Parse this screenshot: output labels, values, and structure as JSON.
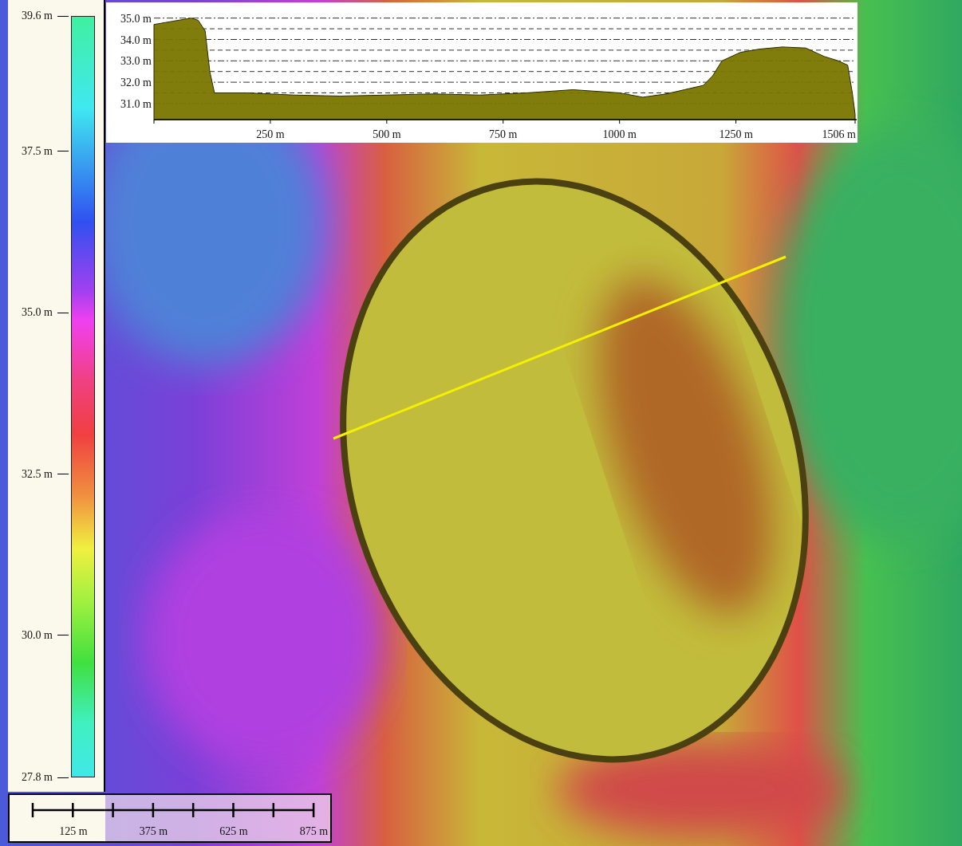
{
  "legend": {
    "labels": [
      "39.6 m",
      "37.5 m",
      "35.0 m",
      "32.5 m",
      "30.0 m",
      "27.8 m"
    ]
  },
  "profile": {
    "chart_data": {
      "type": "area",
      "x": [
        0,
        40,
        80,
        95,
        110,
        120,
        130,
        200,
        300,
        400,
        500,
        600,
        700,
        800,
        900,
        1000,
        1050,
        1100,
        1150,
        1180,
        1200,
        1220,
        1260,
        1300,
        1350,
        1400,
        1440,
        1470,
        1490,
        1500,
        1506
      ],
      "series": [
        {
          "color": "#7a7600",
          "values": [
            34.7,
            34.85,
            35.0,
            34.9,
            34.4,
            32.5,
            31.5,
            31.5,
            31.4,
            31.35,
            31.4,
            31.45,
            31.4,
            31.5,
            31.65,
            31.5,
            31.3,
            31.45,
            31.7,
            31.85,
            32.3,
            33.0,
            33.4,
            33.55,
            33.65,
            33.6,
            33.2,
            33.0,
            32.8,
            31.5,
            30.5
          ]
        }
      ],
      "xlim": [
        0,
        1506
      ],
      "ylim": [
        30.25,
        35.0
      ],
      "grid": true,
      "xticks": [
        {
          "value": 250,
          "label": "250 m"
        },
        {
          "value": 500,
          "label": "500 m"
        },
        {
          "value": 750,
          "label": "750 m"
        },
        {
          "value": 1000,
          "label": "1000 m"
        },
        {
          "value": 1250,
          "label": "1250 m"
        },
        {
          "value": 1506,
          "label": "1506 m"
        }
      ],
      "yticks": [
        {
          "value": 31,
          "label": "31.0 m"
        },
        {
          "value": 32,
          "label": "32.0 m"
        },
        {
          "value": 33,
          "label": "33.0 m"
        },
        {
          "value": 34,
          "label": "34.0 m"
        },
        {
          "value": 35,
          "label": "35.0 m"
        }
      ]
    }
  },
  "scale_bar": {
    "labels": [
      "125 m",
      "375 m",
      "625 m",
      "875 m"
    ]
  }
}
